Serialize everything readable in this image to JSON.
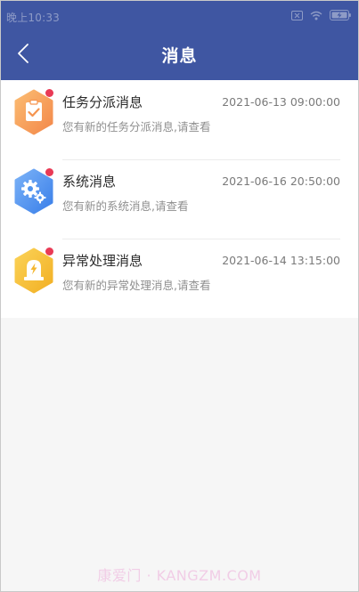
{
  "status_bar": {
    "time": "晚上10:33",
    "icons": [
      "no-sim-icon",
      "wifi-icon",
      "battery-charging-icon"
    ]
  },
  "header": {
    "back_icon": "chevron-left-icon",
    "title": "消息"
  },
  "messages": [
    {
      "title": "任务分派消息",
      "time": "2021-06-13 09:00:00",
      "preview": "您有新的任务分派消息,请查看",
      "icon": "clipboard-check-icon",
      "icon_color": "#f7a05a",
      "unread": true
    },
    {
      "title": "系统消息",
      "time": "2021-06-16 20:50:00",
      "preview": "您有新的系统消息,请查看",
      "icon": "gears-icon",
      "icon_color": "#4f93ee",
      "unread": true
    },
    {
      "title": "异常处理消息",
      "time": "2021-06-14 13:15:00",
      "preview": "您有新的异常处理消息,请查看",
      "icon": "warning-lightning-icon",
      "icon_color": "#f6c23b",
      "unread": true
    }
  ],
  "colors": {
    "header_bg": "#3f56a2",
    "unread_dot": "#e93a55"
  },
  "watermark": "康爱门 · KANGZM.COM"
}
